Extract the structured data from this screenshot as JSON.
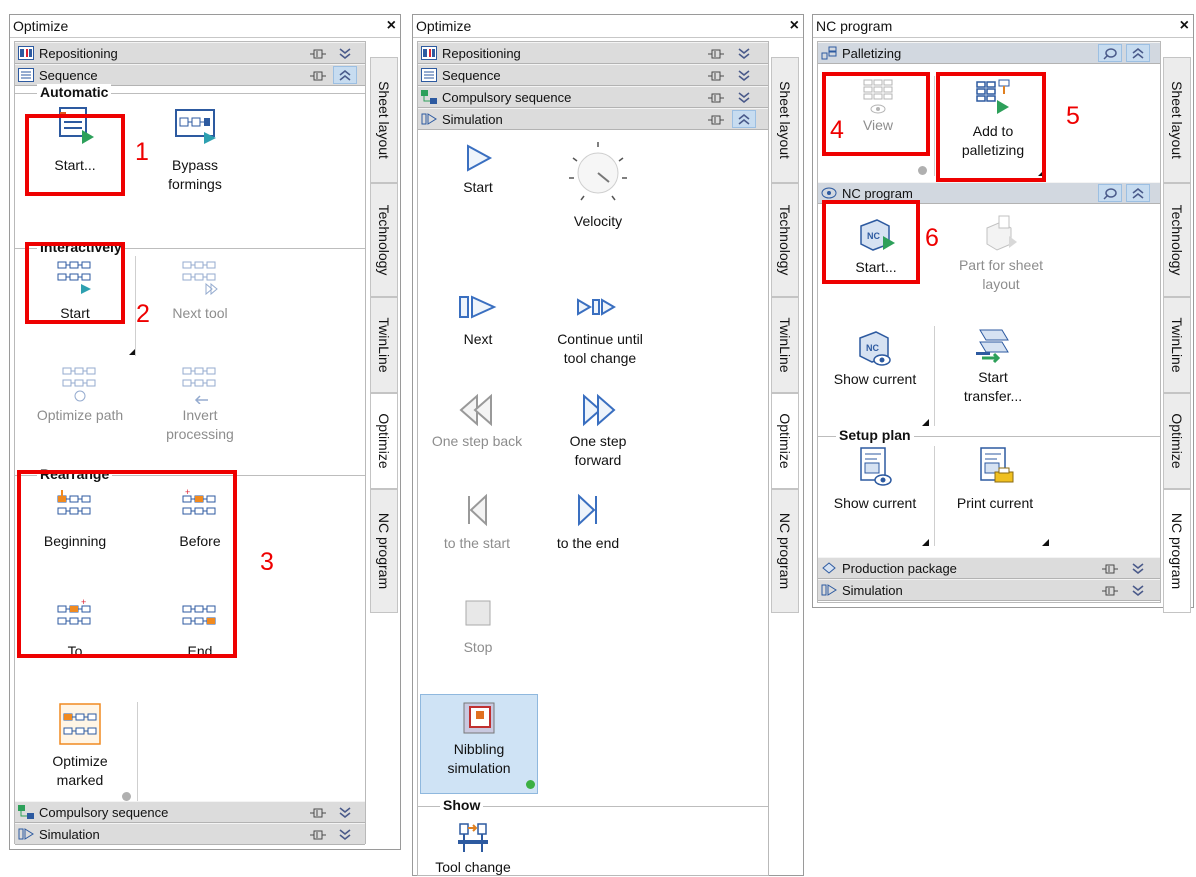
{
  "panel1": {
    "title": "Optimize",
    "close": "×",
    "sections": {
      "repositioning": "Repositioning",
      "sequence": "Sequence",
      "compulsory": "Compulsory sequence",
      "simulation": "Simulation"
    },
    "groups": {
      "automatic": "Automatic",
      "interactively": "Interactively",
      "rearrange": "Rearrange"
    },
    "buttons": {
      "start_auto": "Start...",
      "bypass_1": "Bypass",
      "bypass_2": "formings",
      "start_inter": "Start",
      "next_tool": "Next tool",
      "optimize_path": "Optimize path",
      "invert_1": "Invert",
      "invert_2": "processing",
      "beginning": "Beginning",
      "before": "Before",
      "to": "To",
      "end": "End",
      "optmarked_1": "Optimize",
      "optmarked_2": "marked"
    },
    "tabs": [
      "Sheet layout",
      "Technology",
      "TwinLine",
      "Optimize",
      "NC program"
    ],
    "active_tab": "Optimize",
    "markers": [
      "1",
      "2",
      "3"
    ]
  },
  "panel2": {
    "title": "Optimize",
    "close": "×",
    "sections": {
      "repositioning": "Repositioning",
      "sequence": "Sequence",
      "compulsory": "Compulsory sequence",
      "simulation": "Simulation"
    },
    "buttons": {
      "start": "Start",
      "velocity": "Velocity",
      "next": "Next",
      "continue_1": "Continue until",
      "continue_2": "tool change",
      "stepback": "One step back",
      "stepfwd_1": "One step",
      "stepfwd_2": "forward",
      "tostart": "to the start",
      "toend": "to the end",
      "stop": "Stop",
      "nibbling_1": "Nibbling",
      "nibbling_2": "simulation",
      "toolchange": "Tool change"
    },
    "groups": {
      "show": "Show"
    },
    "tabs": [
      "Sheet layout",
      "Technology",
      "TwinLine",
      "Optimize",
      "NC program"
    ],
    "active_tab": "Optimize"
  },
  "panel3": {
    "title": "NC program",
    "close": "×",
    "sections": {
      "palletizing": "Palletizing",
      "ncprogram": "NC program",
      "production": "Production package",
      "simulation": "Simulation"
    },
    "groups": {
      "setup": "Setup plan"
    },
    "buttons": {
      "view": "View",
      "add_1": "Add to",
      "add_2": "palletizing",
      "start": "Start...",
      "part_1": "Part for sheet",
      "part_2": "layout",
      "show_current": "Show current",
      "transfer_1": "Start",
      "transfer_2": "transfer...",
      "show_current2": "Show current",
      "print_current": "Print current"
    },
    "tabs": [
      "Sheet layout",
      "Technology",
      "TwinLine",
      "Optimize",
      "NC program"
    ],
    "active_tab": "NC program",
    "markers": [
      "4",
      "5",
      "6"
    ]
  },
  "colors": {
    "annotation_red": "#e00000",
    "section_bg": "#dcdcdc",
    "selected_bg": "#cfe3f5"
  }
}
